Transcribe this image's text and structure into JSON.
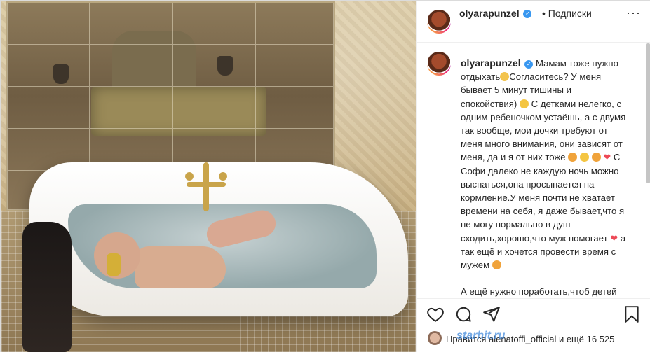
{
  "post": {
    "username": "olyarapunzel",
    "verified_mark": "✓",
    "follow_label": "• Подписки",
    "more_label": "···"
  },
  "caption": {
    "username": "olyarapunzel",
    "paragraph1_a": "Мамам тоже нужно отдыхать",
    "paragraph1_b": "Согласитесь? У меня бывает 5 минут тишины и спокойствия)",
    "paragraph1_c": "С детками нелегко, с одним ребеночком устаёшь, а с двумя так вообще, мои дочки требуют от меня много внимания, они зависят от меня, да и я от них тоже",
    "paragraph1_d": "С Софи далеко не каждую ночь можно выспаться,она просыпается на кормление.У меня почти не хватает времени на себя, я даже бывает,что я не могу нормально в душ сходить,хорошо,что муж помогает",
    "paragraph1_e": "а так ещё и хочется провести время с мужем",
    "paragraph2": "А ещё нужно поработать,чтоб детей"
  },
  "icons": {
    "like": "heart-icon",
    "comment": "comment-icon",
    "share": "share-icon",
    "save": "bookmark-icon",
    "heart_emoji": "❤"
  },
  "likes": {
    "text": "Нравится alenatoffi_official и ещё 16 525"
  },
  "watermark": {
    "text": "starhit.ru"
  }
}
